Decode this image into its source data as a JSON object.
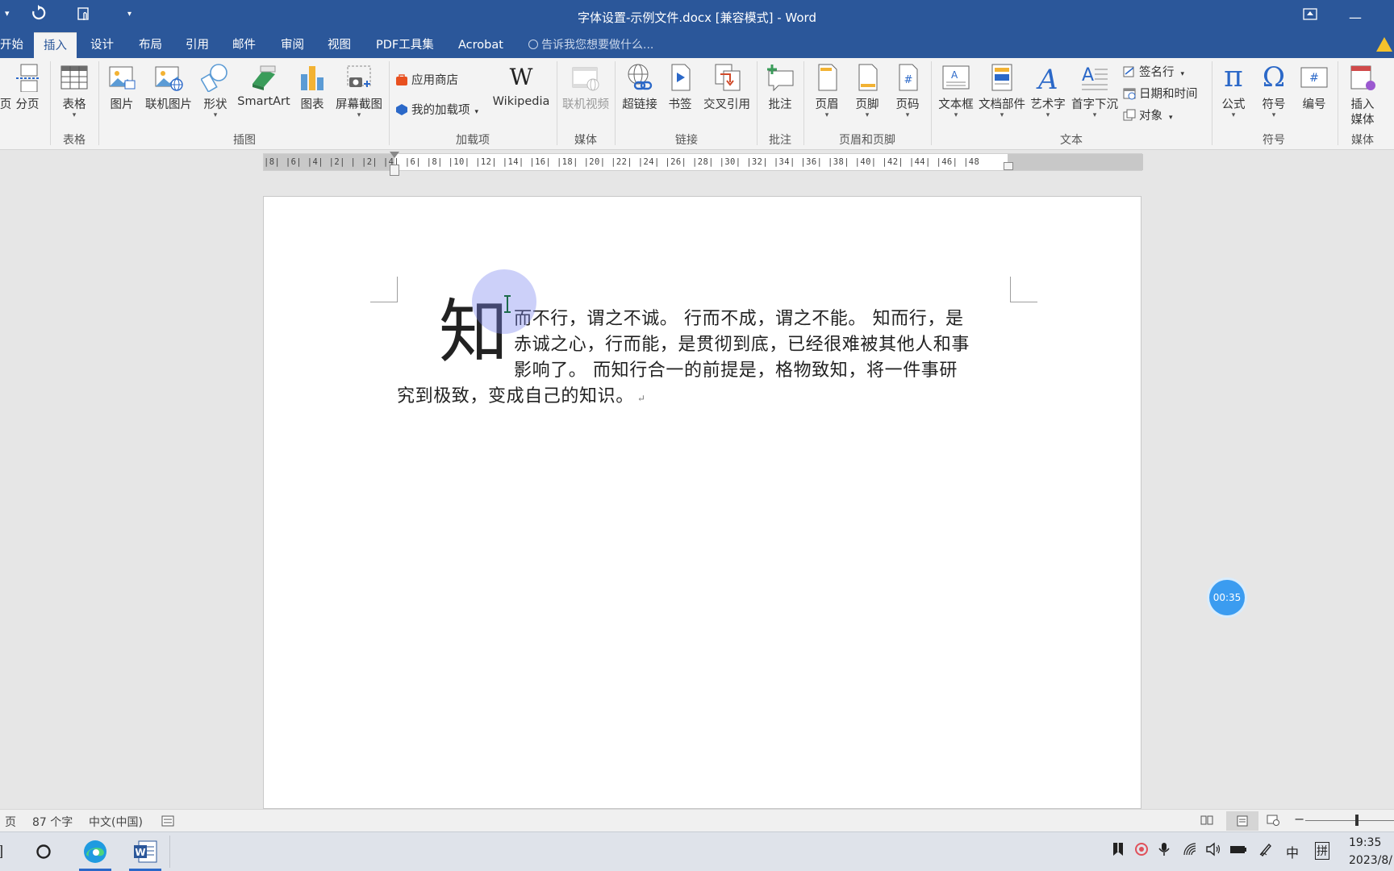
{
  "titlebar": {
    "title": "字体设置-示例文件.docx [兼容模式] - Word",
    "undo_icon": "undo-icon",
    "restore_label": "▣",
    "minimize_label": "—"
  },
  "tabs": [
    {
      "label": "开始",
      "active": false
    },
    {
      "label": "插入",
      "active": true
    },
    {
      "label": "设计",
      "active": false
    },
    {
      "label": "布局",
      "active": false
    },
    {
      "label": "引用",
      "active": false
    },
    {
      "label": "邮件",
      "active": false
    },
    {
      "label": "审阅",
      "active": false
    },
    {
      "label": "视图",
      "active": false
    },
    {
      "label": "PDF工具集",
      "active": false
    },
    {
      "label": "Acrobat",
      "active": false
    }
  ],
  "tell_me": "告诉我您想要做什么...",
  "ribbon": {
    "page_break": {
      "label_partial": "页",
      "label": "分页"
    },
    "table": {
      "label": "表格",
      "group": "表格"
    },
    "illustrations": {
      "group": "插图",
      "picture": "图片",
      "online_picture": "联机图片",
      "shapes": "形状",
      "smartart": "SmartArt",
      "chart": "图表",
      "screenshot": "屏幕截图"
    },
    "addins": {
      "group": "加载项",
      "store": "应用商店",
      "my_addins": "我的加载项",
      "wikipedia": "Wikipedia",
      "wiki_glyph": "W"
    },
    "media": {
      "group": "媒体",
      "online_video": "联机视频"
    },
    "links": {
      "group": "链接",
      "hyperlink": "超链接",
      "bookmark": "书签",
      "cross_ref": "交叉引用"
    },
    "comments": {
      "group": "批注",
      "comment": "批注"
    },
    "header_footer": {
      "group": "页眉和页脚",
      "header": "页眉",
      "footer": "页脚",
      "page_number": "页码"
    },
    "text": {
      "group": "文本",
      "textbox": "文本框",
      "quick_parts": "文档部件",
      "wordart": "艺术字",
      "dropcap": "首字下沉",
      "signature": "签名行",
      "datetime": "日期和时间",
      "object": "对象"
    },
    "symbols": {
      "group": "符号",
      "equation": "公式",
      "symbol": "符号",
      "numbering": "编号",
      "pi": "π",
      "omega": "Ω"
    },
    "media2": {
      "group": "媒体",
      "insert_media_1": "插入",
      "insert_media_2": "媒体"
    }
  },
  "ruler": {
    "numbers": "|8|  |6|  |4|  |2|  |  |2|  |4|  |6|  |8|  |10|  |12|  |14|  |16|  |18|  |20|  |22|  |24|  |26|  |28|  |30|  |32|  |34|  |36|  |38|  |40|  |42|  |44|  |46|  |48"
  },
  "document": {
    "drop_cap": "知",
    "lines": [
      "而不行，谓之不诚。 行而不成，谓之不能。 知而行，是",
      "赤诚之心，行而能，是贯彻到底，已经很难被其他人和事",
      "影响了。 而知行合一的前提是，格物致知，将一件事研",
      "究到极致，变成自己的知识。"
    ],
    "para_mark": "↵"
  },
  "timer": "00:35",
  "statusbar": {
    "page_partial": "页",
    "word_count": "87 个字",
    "language": "中文(中国)"
  },
  "tray": {
    "ime_lang": "中",
    "ime_mode": "拼",
    "time": "19:35",
    "date": "2023/8/"
  },
  "colors": {
    "brand": "#2b579a",
    "accent": "#3b9cf0"
  }
}
